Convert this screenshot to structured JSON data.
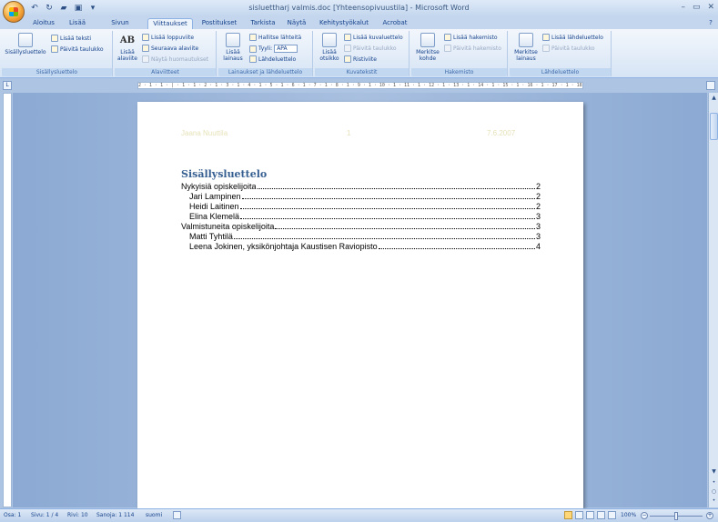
{
  "titlebar": {
    "title": "sisluettharj valmis.doc [Yhteensopivuustila] - Microsoft Word",
    "minimize": "–",
    "restore": "▭",
    "close": "✕",
    "help": "?"
  },
  "qat": {
    "undo": "↶",
    "redo": "↻",
    "open": "▰",
    "save": "▣",
    "customize": "▾"
  },
  "tabs": [
    "Aloitus",
    "Lisää",
    "Sivun asettelu",
    "Viittaukset",
    "Postitukset",
    "Tarkista",
    "Näytä",
    "Kehitystyökalut",
    "Acrobat"
  ],
  "active_tab": "Viittaukset",
  "ribbon": {
    "toc": {
      "big": "Sisällysluettelo",
      "add_text": "Lisää teksti",
      "update": "Päivitä taulukko",
      "title": "Sisällysluettelo"
    },
    "footnotes": {
      "big_icon": "AB",
      "big1": "Lisää",
      "big2": "alaviite",
      "endnote": "Lisää loppuviite",
      "next": "Seuraava alaviite",
      "show": "Näytä huomautukset",
      "title": "Alaviitteet"
    },
    "citations": {
      "big1": "Lisää",
      "big2": "lainaus",
      "manage": "Hallitse lähteitä",
      "style": "Tyyli:",
      "style_value": "APA",
      "biblio": "Lähdeluettelo",
      "title": "Lainaukset ja lähdeluettelo"
    },
    "captions": {
      "big1": "Lisää",
      "big2": "otsikko",
      "insert_tof": "Lisää kuvaluettelo",
      "update": "Päivitä taulukko",
      "cross": "Ristiviite",
      "title": "Kuvatekstit"
    },
    "index": {
      "big1": "Merkitse",
      "big2": "kohde",
      "insert": "Lisää hakemisto",
      "update": "Päivitä hakemisto",
      "title": "Hakemisto"
    },
    "toa": {
      "big1": "Merkitse",
      "big2": "lainaus",
      "insert": "Lisää lähdeluettelo",
      "update": "Päivitä taulukko",
      "title": "Lähdeluettelo"
    }
  },
  "ruler": {
    "corner": "L",
    "marks": "2 · 1 · 1 · | · 1 · 1 · 2 · 1 · 3 · 1 · 4 · 1 · 5 · 1 · 6 · 1 · 7 · 1 · 8 · 1 · 9 · 1 · 10 · 1 · 11 · 1 · 12 · 1 · 13 · 1 · 14 · 1 · 15 · 1 · 16 · 1 · 17 · 1 · 18 ·"
  },
  "document": {
    "header": {
      "left": "Jaana Nuuttila",
      "center": "1",
      "right": "7.6.2007"
    },
    "toc_title": "Sisällysluettelo",
    "entries": [
      {
        "text": "Nykyisiä opiskelijoita",
        "page": "2",
        "level": 1
      },
      {
        "text": "Jari Lampinen",
        "page": "2",
        "level": 2
      },
      {
        "text": "Heidi Laitinen",
        "page": "2",
        "level": 2
      },
      {
        "text": "Elina Klemelä",
        "page": "3",
        "level": 2
      },
      {
        "text": "Valmistuneita opiskelijoita",
        "page": "3",
        "level": 1
      },
      {
        "text": "Matti Tyhtilä",
        "page": "3",
        "level": 2
      },
      {
        "text": "Leena Jokinen, yksikönjohtaja Kaustisen Raviopisto",
        "page": "4",
        "level": 2
      }
    ]
  },
  "status": {
    "section": "Osa: 1",
    "page": "Sivu: 1 / 4",
    "line": "Rivi: 10",
    "words": "Sanoja: 1 114",
    "language": "suomi",
    "zoom": "100%",
    "zoom_out": "−",
    "zoom_in": "+"
  },
  "scroll": {
    "up": "▲",
    "down": "▼",
    "prev": "•",
    "browse": "○",
    "next": "•"
  }
}
